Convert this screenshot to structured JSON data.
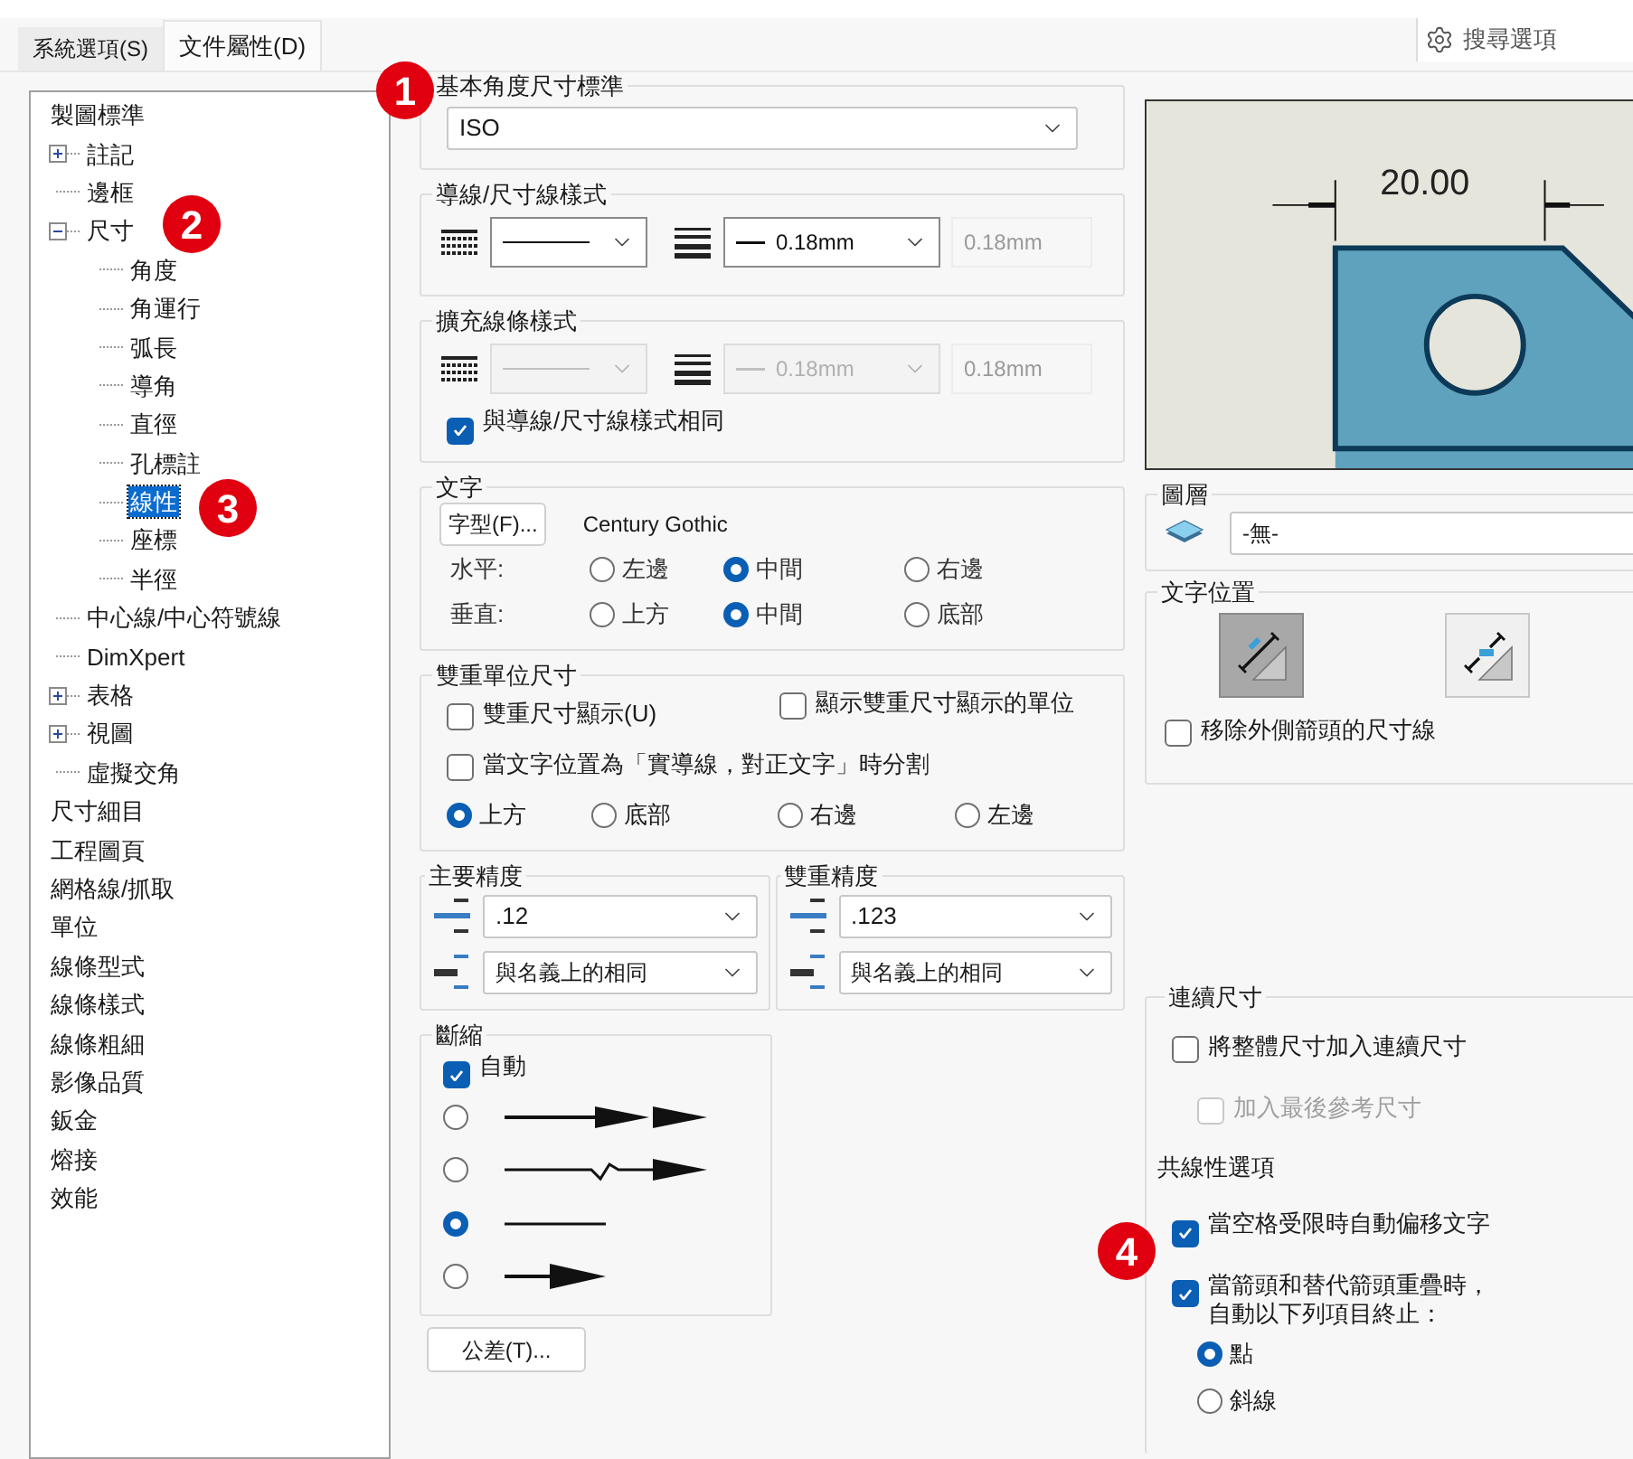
{
  "tabs": [
    {
      "label": "系統選項(S)",
      "selected": false
    },
    {
      "label": "文件屬性(D)",
      "selected": true
    }
  ],
  "search": {
    "placeholder": "搜尋選項"
  },
  "tree": [
    {
      "label": "製圖標準",
      "selected": false,
      "children": [
        {
          "label": "註記",
          "selected": false,
          "expanded": false
        },
        {
          "label": "邊框",
          "selected": false
        },
        {
          "label": "尺寸",
          "selected": false,
          "expanded": true,
          "children": [
            {
              "label": "角度",
              "selected": false
            },
            {
              "label": "角運行",
              "selected": false
            },
            {
              "label": "弧長",
              "selected": false
            },
            {
              "label": "導角",
              "selected": false
            },
            {
              "label": "直徑",
              "selected": false
            },
            {
              "label": "孔標註",
              "selected": false
            },
            {
              "label": "線性",
              "selected": true
            },
            {
              "label": "座標",
              "selected": false
            },
            {
              "label": "半徑",
              "selected": false
            }
          ]
        },
        {
          "label": "中心線/中心符號線",
          "selected": false
        },
        {
          "label": "DimXpert",
          "selected": false
        },
        {
          "label": "表格",
          "selected": false,
          "expanded": false
        },
        {
          "label": "視圖",
          "selected": false,
          "expanded": false
        },
        {
          "label": "虛擬交角",
          "selected": false
        }
      ]
    },
    {
      "label": "尺寸細目",
      "selected": false
    },
    {
      "label": "工程圖頁",
      "selected": false
    },
    {
      "label": "網格線/抓取",
      "selected": false
    },
    {
      "label": "單位",
      "selected": false
    },
    {
      "label": "線條型式",
      "selected": false
    },
    {
      "label": "線條樣式",
      "selected": false
    },
    {
      "label": "線條粗細",
      "selected": false
    },
    {
      "label": "影像品質",
      "selected": false
    },
    {
      "label": "鈑金",
      "selected": false
    },
    {
      "label": "熔接",
      "selected": false
    },
    {
      "label": "效能",
      "selected": false
    }
  ],
  "standard": {
    "title": "基本角度尺寸標準",
    "value": "ISO"
  },
  "leader_style": {
    "title": "導線/尺寸線樣式",
    "thickness": "0.18mm",
    "custom": "0.18mm",
    "disabled": false
  },
  "extension_style": {
    "title": "擴充線條樣式",
    "thickness": "0.18mm",
    "custom": "0.18mm",
    "disabled": true,
    "same_as_leader": {
      "label": "與導線/尺寸線樣式相同",
      "checked": true
    }
  },
  "text": {
    "title": "文字",
    "font_button": "字型(F)...",
    "font_name": "Century Gothic",
    "rows": [
      {
        "label": "水平:",
        "options": [
          {
            "label": "左邊",
            "selected": false
          },
          {
            "label": "中間",
            "selected": true
          },
          {
            "label": "右邊",
            "selected": false
          }
        ]
      },
      {
        "label": "垂直:",
        "options": [
          {
            "label": "上方",
            "selected": false
          },
          {
            "label": "中間",
            "selected": true
          },
          {
            "label": "底部",
            "selected": false
          }
        ]
      }
    ]
  },
  "dual": {
    "title": "雙重單位尺寸",
    "checks": [
      {
        "label": "雙重尺寸顯示(U)",
        "checked": false
      },
      {
        "label": "顯示雙重尺寸顯示的單位",
        "checked": false
      }
    ],
    "split": {
      "label": "當文字位置為「實導線，對正文字」時分割",
      "checked": false
    },
    "positions": [
      {
        "label": "上方",
        "selected": true
      },
      {
        "label": "底部",
        "selected": false
      },
      {
        "label": "右邊",
        "selected": false
      },
      {
        "label": "左邊",
        "selected": false
      }
    ]
  },
  "precision": [
    {
      "title": "主要精度",
      "value": ".12",
      "tolerance": "與名義上的相同"
    },
    {
      "title": "雙重精度",
      "value": ".123",
      "tolerance": "與名義上的相同"
    }
  ],
  "break": {
    "title": "斷縮",
    "auto": {
      "label": "自動",
      "checked": true
    },
    "options": [
      {
        "kind": "double_arrow",
        "selected": false
      },
      {
        "kind": "zigzag",
        "selected": false
      },
      {
        "kind": "line",
        "selected": true
      },
      {
        "kind": "arrow",
        "selected": false
      }
    ]
  },
  "tolerance_button": "公差(T)...",
  "preview": {
    "dimension": "20.00"
  },
  "layer": {
    "title": "圖層",
    "value": "-無-"
  },
  "text_position": {
    "title": "文字位置",
    "options": [
      {
        "kind": "above",
        "selected": true
      },
      {
        "kind": "inline",
        "selected": false
      }
    ],
    "remove_outside": {
      "label": "移除外側箭頭的尺寸線",
      "checked": false
    }
  },
  "chain": {
    "title": "連續尺寸",
    "add_overall": {
      "label": "將整體尺寸加入連續尺寸",
      "checked": false
    },
    "add_last": {
      "label": "加入最後參考尺寸",
      "checked": false,
      "disabled": true
    },
    "collinear_label": "共線性選項",
    "offset_text": {
      "label": "當空格受限時自動偏移文字",
      "checked": true
    },
    "terminate": {
      "label": "當箭頭和替代箭頭重疊時，自動以下列項目終止：",
      "checked": true
    },
    "terminators": [
      {
        "label": "點",
        "selected": true
      },
      {
        "label": "斜線",
        "selected": false
      }
    ]
  },
  "callouts": [
    "1",
    "2",
    "3",
    "4"
  ]
}
